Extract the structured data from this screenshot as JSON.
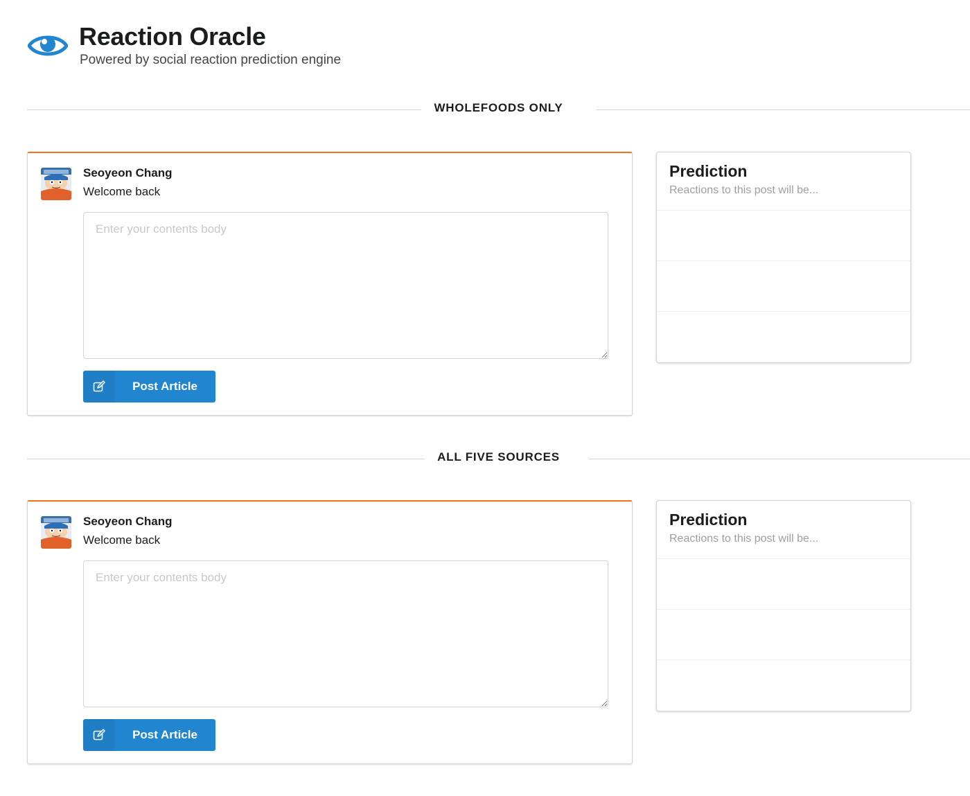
{
  "header": {
    "title": "Reaction Oracle",
    "subtitle": "Powered by social reaction prediction engine",
    "accent_color": "#2185d0",
    "icon": "eye-icon"
  },
  "sections": [
    {
      "label": "WHOLEFOODS ONLY",
      "post": {
        "user_name": "Seoyeon Chang",
        "greeting": "Welcome back",
        "body_placeholder": "Enter your contents body",
        "body_value": "",
        "button_label": "Post Article",
        "button_icon": "edit-icon"
      },
      "prediction": {
        "title": "Prediction",
        "subtitle": "Reactions to this post will be...",
        "rows": [
          "",
          "",
          ""
        ]
      }
    },
    {
      "label": "ALL FIVE SOURCES",
      "post": {
        "user_name": "Seoyeon Chang",
        "greeting": "Welcome back",
        "body_placeholder": "Enter your contents body",
        "body_value": "",
        "button_label": "Post Article",
        "button_icon": "edit-icon"
      },
      "prediction": {
        "title": "Prediction",
        "subtitle": "Reactions to this post will be...",
        "rows": [
          "",
          "",
          ""
        ]
      }
    }
  ],
  "colors": {
    "card_top_border": "#f2711c",
    "button": "#2185d0"
  }
}
